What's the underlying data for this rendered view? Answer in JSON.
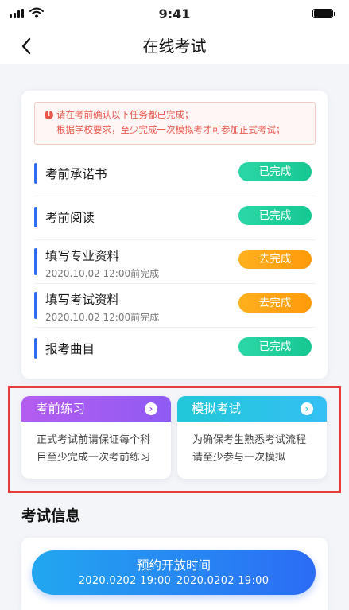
{
  "status_bar": {
    "time": "9:41"
  },
  "nav": {
    "title": "在线考试",
    "back_icon": "chevron-left-icon"
  },
  "notice": {
    "line1": "请在考前确认以下任务都已完成；",
    "line2": "根据学校要求，至少完成一次模拟考才可参加正式考试；",
    "icon": "alert-icon",
    "color": "#e8574c"
  },
  "tasks": [
    {
      "name": "考前承诺书",
      "deadline": "",
      "status": "已完成"
    },
    {
      "name": "考前阅读",
      "deadline": "",
      "status": "已完成"
    },
    {
      "name": "填写专业资料",
      "deadline": "2020.10.02 12:00前完成",
      "status": "去完成"
    },
    {
      "name": "填写考试资料",
      "deadline": "2020.10.02 12:00前完成",
      "status": "去完成"
    },
    {
      "name": "报考曲目",
      "deadline": "",
      "status": "已完成"
    }
  ],
  "modes": {
    "practice": {
      "title": "考前练习",
      "desc": "正式考试前请保证每个科目至少完成一次考前练习"
    },
    "mock": {
      "title": "模拟考试",
      "desc": "为确保考生熟悉考试流程请至少参与一次模拟"
    }
  },
  "exam_info": {
    "section_title": "考试信息",
    "button_label": "预约开放时间",
    "button_time": "2020.0202 19:00–2020.0202 19:00"
  },
  "colors": {
    "accent": "#2f6cf4",
    "done": "#16c792",
    "todo": "#ff9a0a",
    "practice": "#9e5bf2",
    "mock": "#2bc3e6",
    "highlight_box": "#e83c3c"
  }
}
